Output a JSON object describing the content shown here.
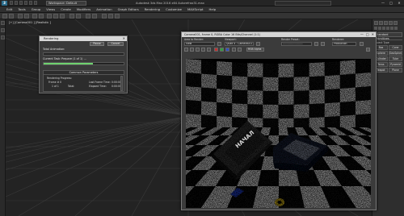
{
  "titlebar": {
    "workspace": "Workspace: Default",
    "title": "Autodesk 3ds Max 2016 x64    Autorefrao31.max",
    "win_min": "—",
    "win_max": "□",
    "win_close": "✕"
  },
  "menubar": {
    "items": [
      "Edit",
      "Tools",
      "Group",
      "Views",
      "Create",
      "Modifiers",
      "Animation",
      "Graph Editors",
      "Rendering",
      "Customize",
      "MAXScript",
      "Help"
    ]
  },
  "viewport": {
    "label": "[+] [Camera001 ] [Realistic ]"
  },
  "command_panel": {
    "category": "Standard Primitives",
    "section": "Object Type",
    "buttons": [
      "Box",
      "Cone",
      "Sphere",
      "GeoSphere",
      "Cylinder",
      "Tube",
      "Torus",
      "Pyramid",
      "Teapot",
      "Plane"
    ]
  },
  "render_dialog": {
    "title": "Rendering",
    "pause_label": "Pause",
    "cancel_label": "Cancel",
    "total_animation_label": "Total Animation:",
    "current_task_label": "Current Task:",
    "current_task_value": "Prepare (1 of 1) ...",
    "progress_fraction": 0.62,
    "common_params_label": "Common Parameters",
    "rendering_progress_label": "Rendering Progress:",
    "frame_label": "Frame #",
    "frame_value": "0",
    "range_label": "1 of 1",
    "total_label": "Total:",
    "last_frame_time_label": "Last Frame Time:",
    "last_frame_time_value": "0:00:00",
    "elapsed_time_label": "Elapsed Time:",
    "elapsed_time_value": "0:00:00"
  },
  "frame_buffer": {
    "title": "Camera001, frame 0, RGBA Color 16 Bits/Channel (1:1)",
    "area_to_render_label": "Area to Render:",
    "viewport_label": "Viewport:",
    "render_preset_label": "Render Preset:",
    "renderer_label": "Renderer:",
    "area_value": "View",
    "viewport_value": "Quad 4 - Camera001",
    "preset_value": "----------------------",
    "renderer_value": "Production",
    "channel_value": "RGB Alpha",
    "colors": {
      "red_chip": "#c03030",
      "green_chip": "#30a040",
      "blue_chip": "#3050c0"
    }
  },
  "scene": {
    "box_text": "НАЧАЛ"
  }
}
